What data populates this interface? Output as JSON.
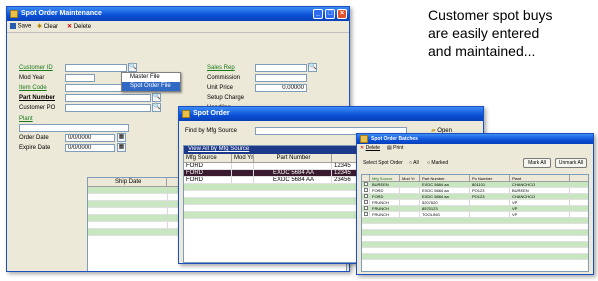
{
  "callout": {
    "line1": "Customer spot buys",
    "line2": "are easily entered",
    "line3": "and maintained..."
  },
  "win1": {
    "title": "Spot Order Maintenance",
    "toolbar": {
      "save": "Save",
      "clear": "Clear",
      "delete": "Delete"
    },
    "labels": {
      "customer_id": "Customer ID",
      "mod_year": "Mod Year",
      "item_code": "Item Code",
      "part_number": "Part Number",
      "customer_po": "Customer PO",
      "plant": "Plant",
      "order_date": "Order Date",
      "expire_date": "Expire Date",
      "sales_rep": "Sales Rep",
      "commission": "Commission",
      "unit_price": "Unit Price",
      "setup_charge": "Setup Charge",
      "handling": "Handling"
    },
    "values": {
      "unit_price": "0.00000",
      "order_date": "0/0/0000",
      "expire_date": "0/0/0000"
    },
    "popup_menu": [
      "Master File",
      "Spot Order File"
    ],
    "grid_headers": [
      "Ship Date"
    ]
  },
  "win2": {
    "title": "Spot Order",
    "find_label": "Find by Mfg Source",
    "open_label": "Open",
    "view_label": "View All by Mfg Source",
    "headers": [
      "Mfg Source",
      "Mod Yr",
      "Part Number",
      ""
    ],
    "rows": [
      [
        "FORD",
        "",
        "",
        "12345"
      ],
      [
        "FORD",
        "",
        "EXDC 5684 AA",
        "12345"
      ],
      [
        "FORD",
        "",
        "EXDC 5684 AA",
        "23456"
      ]
    ]
  },
  "win3": {
    "title": "Spot Order Batches",
    "toolbar": {
      "delete": "Delete",
      "print": "Print"
    },
    "select_label": "Select Spot Order",
    "radio_all": "All",
    "radio_marked": "Marked",
    "mark_all": "Mark All",
    "unmark_all": "Unmark All",
    "headers": [
      "Mfg Source",
      "Mod Yr",
      "Part Number",
      "Po Number",
      "Plant"
    ],
    "rows": [
      [
        "BUREEN",
        "",
        "EXDC 5684 aa",
        "801101",
        "CHANCHCO"
      ],
      [
        "FORD",
        "",
        "EXDC 5684 aa",
        "PO123",
        "BUREEN"
      ],
      [
        "FORD",
        "",
        "EXDC 5684 aa",
        "PO123",
        "CHANCHCO"
      ],
      [
        "FRUNCH",
        "",
        "5207620",
        "",
        "VP"
      ],
      [
        "FRUNCH",
        "",
        "8570123",
        "",
        "VP"
      ],
      [
        "FRUNCH",
        "",
        "TOOLING",
        "",
        "VP"
      ]
    ]
  }
}
